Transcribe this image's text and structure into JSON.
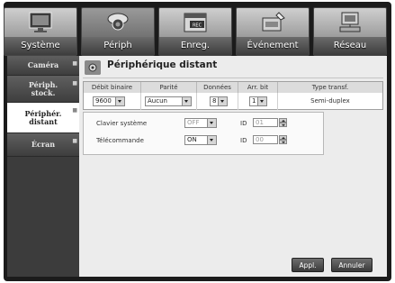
{
  "tabs": [
    {
      "label": "Système",
      "icon": "monitor-icon"
    },
    {
      "label": "Périph",
      "icon": "camera-icon"
    },
    {
      "label": "Enreg.",
      "icon": "record-icon"
    },
    {
      "label": "Événement",
      "icon": "event-icon"
    },
    {
      "label": "Réseau",
      "icon": "network-icon"
    }
  ],
  "sidebar": {
    "items": [
      {
        "label": "Caméra"
      },
      {
        "label": "Périph. stock."
      },
      {
        "label": "Périphér. distant"
      },
      {
        "label": "Écran"
      }
    ]
  },
  "panel": {
    "title": "Périphérique distant",
    "table": {
      "headers": [
        "Débit binaire",
        "Parité",
        "Données",
        "Arr. bit",
        "Type transf."
      ],
      "baud": "9600",
      "parity": "Aucun",
      "data_bits": "8",
      "stop_bit": "1",
      "transfer_type": "Semi-duplex"
    },
    "keyboard": {
      "label": "Clavier système",
      "state": "OFF",
      "id_label": "ID",
      "id_value": "01"
    },
    "remote": {
      "label": "Télécommande",
      "state": "ON",
      "id_label": "ID",
      "id_value": "00"
    }
  },
  "buttons": {
    "apply": "Appl.",
    "cancel": "Annuler"
  },
  "colors": {
    "frame": "#1b1b1b",
    "panel": "#ececec",
    "sidebar_active": "#ffffff"
  }
}
